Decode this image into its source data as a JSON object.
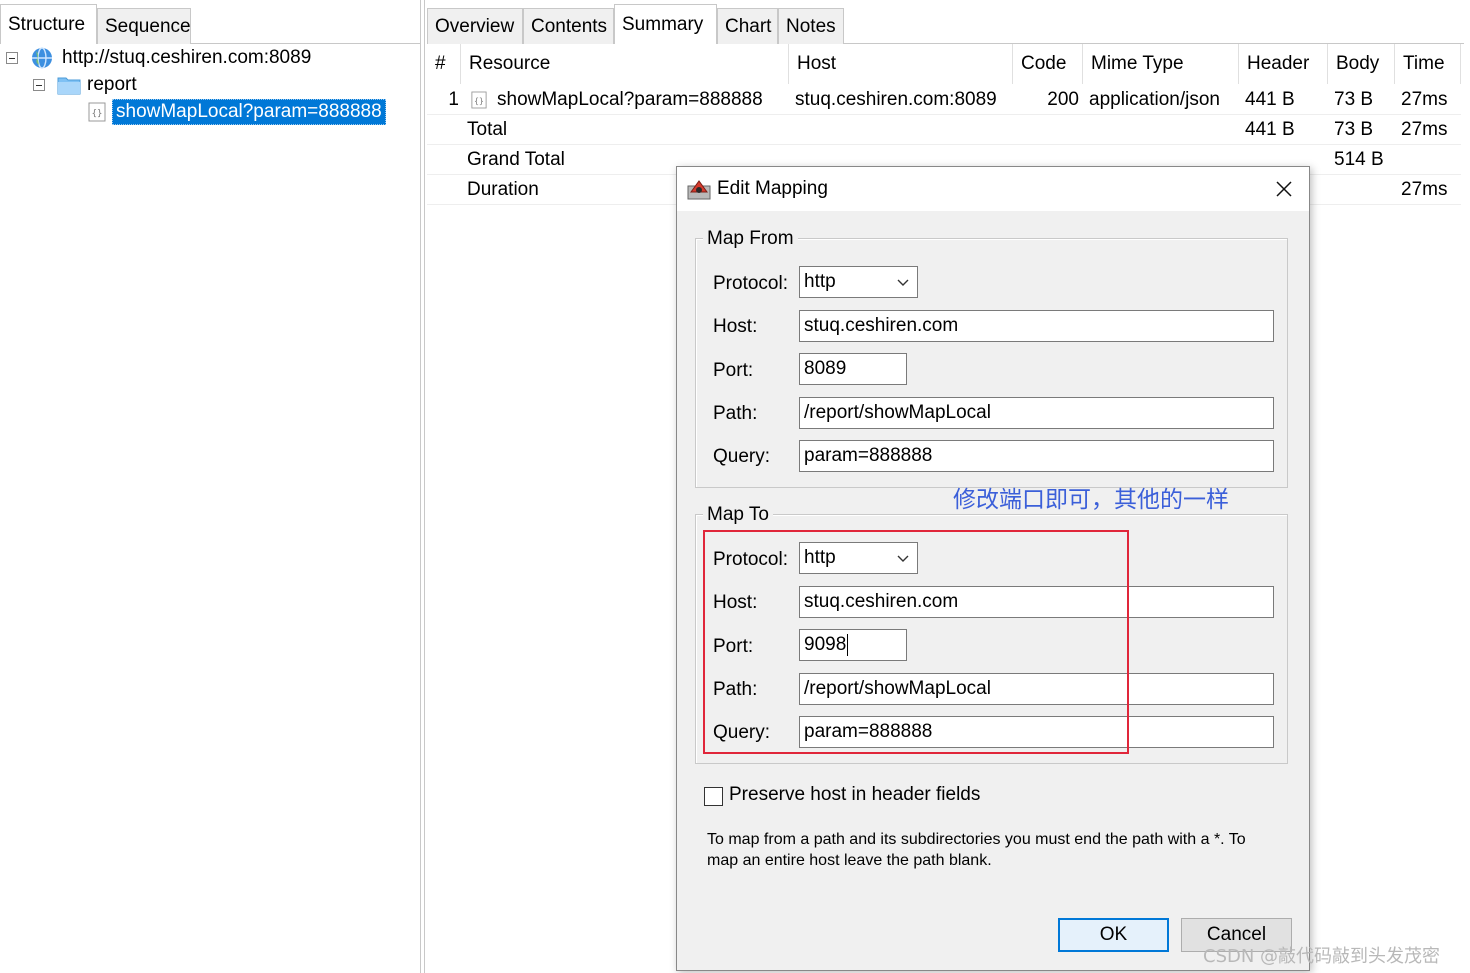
{
  "left_tabs": [
    "Structure",
    "Sequence"
  ],
  "tree": {
    "host": "http://stuq.ceshiren.com:8089",
    "folder": "report",
    "selected": "showMapLocal?param=888888"
  },
  "right_tabs": [
    "Overview",
    "Contents",
    "Summary",
    "Chart",
    "Notes"
  ],
  "table": {
    "columns": [
      "#",
      "Resource",
      "Host",
      "Code",
      "Mime Type",
      "Header",
      "Body",
      "Time"
    ],
    "row1": {
      "num": "1",
      "resource": "showMapLocal?param=888888",
      "host": "stuq.ceshiren.com:8089",
      "code": "200",
      "mime": "application/json",
      "header": "441 B",
      "body": "73 B",
      "time": "27ms"
    },
    "total": {
      "label": "Total",
      "header": "441 B",
      "body": "73 B",
      "time": "27ms"
    },
    "grand_total": {
      "label": "Grand Total",
      "body": "514 B"
    },
    "duration": {
      "label": "Duration",
      "time": "27ms"
    }
  },
  "dialog": {
    "title": "Edit Mapping",
    "map_from": {
      "title": "Map From",
      "protocol_label": "Protocol:",
      "protocol": "http",
      "host_label": "Host:",
      "host": "stuq.ceshiren.com",
      "port_label": "Port:",
      "port": "8089",
      "path_label": "Path:",
      "path": "/report/showMapLocal",
      "query_label": "Query:",
      "query": "param=888888"
    },
    "annotation": "修改端口即可，其他的一样",
    "map_to": {
      "title": "Map To",
      "protocol_label": "Protocol:",
      "protocol": "http",
      "host_label": "Host:",
      "host": "stuq.ceshiren.com",
      "port_label": "Port:",
      "port": "9098",
      "path_label": "Path:",
      "path": "/report/showMapLocal",
      "query_label": "Query:",
      "query": "param=888888"
    },
    "preserve_host_label": "Preserve host in header fields",
    "help_line1": "To map from a path and its subdirectories you must end the path with a *. To",
    "help_line2": "map an entire host leave the path blank.",
    "ok_label": "OK",
    "cancel_label": "Cancel"
  },
  "watermark": "CSDN @敲代码敲到头发茂密",
  "colors": {
    "selection": "#0078d7",
    "annotation_text": "#3b5fd9",
    "highlight_box": "#e0263a"
  }
}
